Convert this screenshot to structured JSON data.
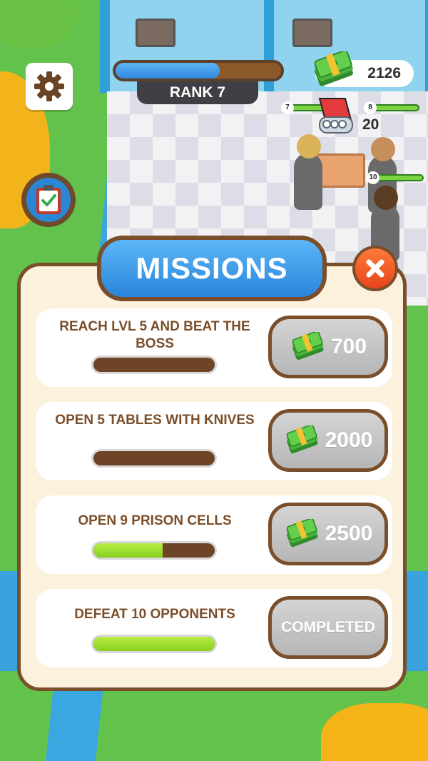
{
  "hud": {
    "rank_label": "RANK 7",
    "rank_progress_fraction": 0.63,
    "money": "2126",
    "item_count": "20",
    "settings_icon": "gear-icon",
    "missions_icon": "clipboard-check-icon"
  },
  "scene": {
    "player_levels": [
      "7",
      "8",
      "10"
    ]
  },
  "missions_panel": {
    "title": "MISSIONS",
    "close_icon": "close-icon",
    "missions": [
      {
        "label": "REACH LVL 5 AND BEAT THE BOSS",
        "progress": 0.0,
        "reward": "700",
        "reward_icon": "cash-icon"
      },
      {
        "label": "OPEN 5 TABLES WITH KNIVES",
        "progress": 0.0,
        "reward": "2000",
        "reward_icon": "cash-icon"
      },
      {
        "label": "OPEN 9 PRISON CELLS",
        "progress": 0.57,
        "reward": "2500",
        "reward_icon": "cash-icon"
      },
      {
        "label": "DEFEAT 10 OPPONENTS",
        "progress": 1.0,
        "reward": "COMPLETED",
        "reward_icon": ""
      }
    ]
  },
  "colors": {
    "panel_border": "#7a4e2a",
    "title_blue": "#2a85dc",
    "progress_green": "#86cf1f",
    "close_orange": "#e8441a"
  }
}
